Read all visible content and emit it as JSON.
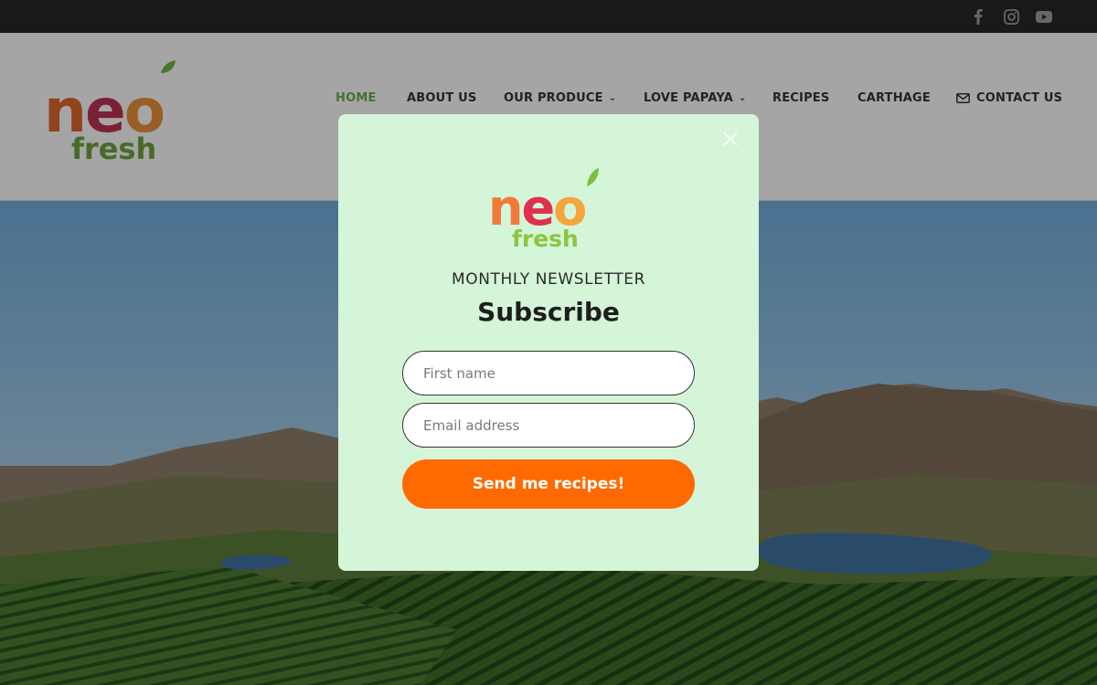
{
  "social": {
    "icons": [
      "facebook-icon",
      "instagram-icon",
      "youtube-icon"
    ]
  },
  "brand": {
    "logo_top": "neo",
    "logo_bottom": "fresh"
  },
  "nav": {
    "items": [
      {
        "label": "HOME",
        "active": true
      },
      {
        "label": "ABOUT US"
      },
      {
        "label": "OUR PRODUCE",
        "dropdown": true
      },
      {
        "label": "LOVE PAPAYA",
        "dropdown": true
      },
      {
        "label": "RECIPES"
      },
      {
        "label": "CARTHAGE"
      },
      {
        "label": "CONTACT US",
        "icon": "envelope-icon"
      }
    ],
    "caret": "⌄"
  },
  "modal": {
    "close_icon": "close-icon",
    "eyebrow": "MONTHLY NEWSLETTER",
    "title": "Subscribe",
    "first_name_placeholder": "First name",
    "email_placeholder": "Email address",
    "submit_label": "Send me recipes!"
  },
  "colors": {
    "accent_orange": "#ff6a00",
    "nav_active": "#6aa84f",
    "modal_bg": "#d5f5d8",
    "topbar": "#262626"
  }
}
